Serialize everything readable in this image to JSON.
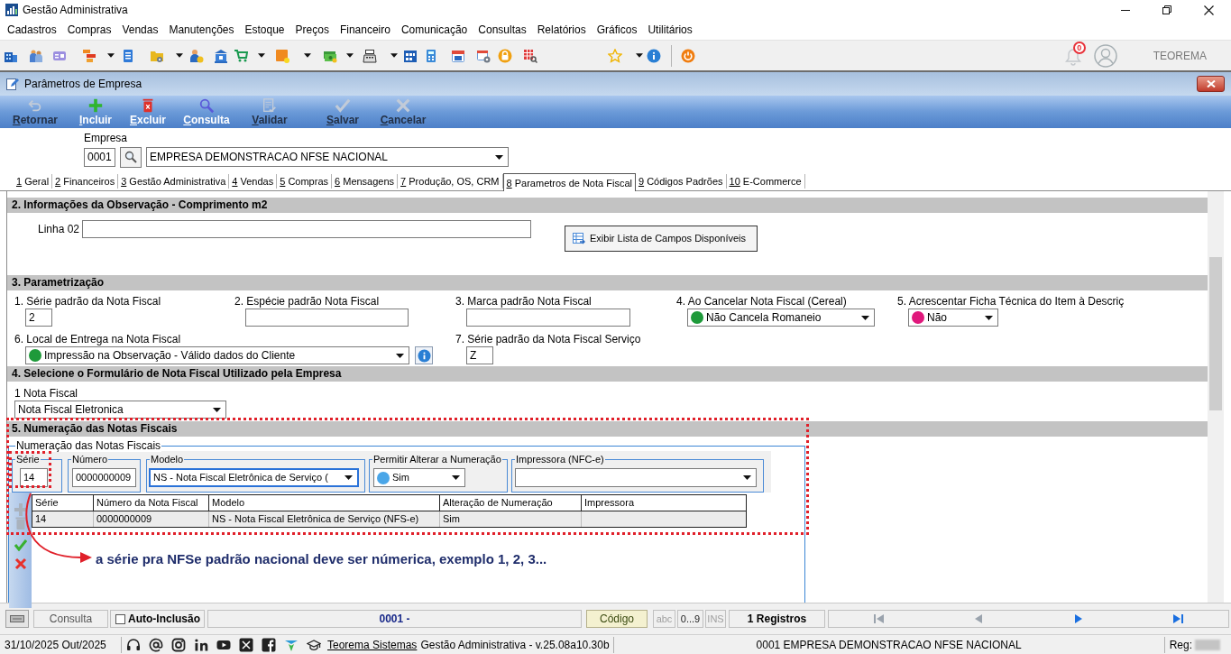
{
  "window": {
    "title": "Gestão Administrativa"
  },
  "menu": [
    "Cadastros",
    "Compras",
    "Vendas",
    "Manutenções",
    "Estoque",
    "Preços",
    "Financeiro",
    "Comunicação",
    "Consultas",
    "Relatórios",
    "Gráficos",
    "Utilitários"
  ],
  "header": {
    "notifications": "0",
    "user": "TEOREMA"
  },
  "form": {
    "title": "Parâmetros de Empresa",
    "toolbar": [
      {
        "kind": "back",
        "label": "Retornar",
        "disabled": true
      },
      {
        "kind": "add",
        "label": "Incluir",
        "disabled": false
      },
      {
        "kind": "delete",
        "label": "Excluir",
        "disabled": false
      },
      {
        "kind": "search",
        "label": "Consulta",
        "disabled": false
      },
      {
        "kind": "validate",
        "label": "Validar",
        "disabled": true
      },
      {
        "kind": "save",
        "label": "Salvar",
        "disabled": true
      },
      {
        "kind": "cancel",
        "label": "Cancelar",
        "disabled": true
      }
    ],
    "company": {
      "label": "Empresa",
      "code": "0001",
      "name": "EMPRESA DEMONSTRACAO NFSE NACIONAL"
    },
    "tabs": [
      {
        "key": "1",
        "label": "Geral",
        "selected": false
      },
      {
        "key": "2",
        "label": "Financeiros",
        "selected": false
      },
      {
        "key": "3",
        "label": "Gestão Administrativa",
        "selected": false
      },
      {
        "key": "4",
        "label": "Vendas",
        "selected": false
      },
      {
        "key": "5",
        "label": "Compras",
        "selected": false
      },
      {
        "key": "6",
        "label": "Mensagens",
        "selected": false
      },
      {
        "key": "7",
        "label": "Produção, OS, CRM",
        "selected": false
      },
      {
        "key": "8",
        "label": "Parametros de Nota Fiscal",
        "selected": true
      },
      {
        "key": "9",
        "label": "Códigos Padrões",
        "selected": false
      },
      {
        "key": "10",
        "label": "E-Commerce",
        "selected": false
      }
    ]
  },
  "observation": {
    "title": "2. Informações da Observação - Comprimento m2",
    "field_label": "Linha 02",
    "button": "Exibir Lista de Campos Disponíveis"
  },
  "parametrization": {
    "title": "3. Parametrização",
    "fields": [
      {
        "kind": "text",
        "label": "1. Série padrão da Nota Fiscal",
        "value": "2"
      },
      {
        "kind": "text",
        "label": "2. Espécie padrão Nota Fiscal"
      },
      {
        "kind": "text",
        "label": "3. Marca padrão Nota Fiscal"
      },
      {
        "kind": "select",
        "label": "4. Ao Cancelar Nota Fiscal (Cereal)",
        "value": "Não Cancela Romaneio",
        "color": "#1e9a3a"
      },
      {
        "kind": "select",
        "label": "5. Acrescentar Ficha Técnica do Item à Descriç",
        "value": "Não",
        "color": "#e0187c"
      },
      {
        "kind": "select",
        "label": "6. Local de Entrega na Nota Fiscal",
        "value": "Impressão na Observação - Válido dados do Cliente",
        "color": "#1e9a3a"
      },
      {
        "kind": "text",
        "label": "7. Série padrão da Nota Fiscal Serviço",
        "value": "Z"
      }
    ]
  },
  "invoice_form": {
    "title": "4. Selecione o Formulário de Nota Fiscal Utilizado pela Empresa",
    "label": "1 Nota Fiscal",
    "value": "Nota Fiscal Eletronica"
  },
  "numbering": {
    "title": "5. Numeração das Notas Fiscais",
    "group": "Numeração das Notas Fiscais",
    "fields": [
      {
        "kind": "text",
        "label": "Série",
        "value": "14",
        "focused": false
      },
      {
        "kind": "text",
        "label": "Número",
        "value": "0000000009",
        "focused": false
      },
      {
        "kind": "select",
        "label": "Modelo",
        "value": "NS - Nota Fiscal Eletrônica de Serviço (",
        "focused": true
      },
      {
        "kind": "select",
        "label": "Permitir Alterar a Numeração",
        "value": "Sim",
        "color": "#4aa6e8",
        "focused": false
      },
      {
        "kind": "select",
        "label": "Impressora (NFC-e)",
        "focused": false
      }
    ],
    "grid_actions": [
      {
        "kind": "add",
        "disabled": true
      },
      {
        "kind": "delete",
        "disabled": true
      },
      {
        "kind": "confirm",
        "disabled": false
      },
      {
        "kind": "cancel",
        "disabled": false
      }
    ],
    "table": {
      "columns": [
        "Série",
        "Número da Nota Fiscal",
        "Modelo",
        "Alteração de Numeração",
        "Impressora"
      ],
      "rows": [
        {
          "cells": [
            "14",
            "0000000009",
            "NS - Nota Fiscal Eletrônica de Serviço (NFS-e)",
            "Sim"
          ]
        }
      ]
    }
  },
  "annotation": {
    "note": "a série pra NFSe padrão nacional deve ser númerica, exemplo 1, 2, 3..."
  },
  "bottom_bar": {
    "mode": "Consulta",
    "auto_include": {
      "label": "Auto-Inclusão",
      "checked": false
    },
    "key_value": "0001 -",
    "search_field": "Código",
    "indicators": [
      {
        "label": "abc",
        "on": false
      },
      {
        "label": "0...9",
        "on": true
      },
      {
        "label": "INS",
        "on": false
      }
    ],
    "record_count": "1 Registros",
    "nav_buttons": [
      {
        "kind": "first",
        "disabled": true
      },
      {
        "kind": "previous",
        "disabled": true
      },
      {
        "kind": "next",
        "disabled": false
      },
      {
        "kind": "last",
        "disabled": false
      }
    ]
  },
  "status_bar": {
    "date": "31/10/2025 Out/2025",
    "link": "Teorema Sistemas",
    "version": "Gestão Administrativa - v.25.08a10.30b",
    "company": "0001 EMPRESA DEMONSTRACAO NFSE NACIONAL",
    "reg_label": "Reg:"
  }
}
